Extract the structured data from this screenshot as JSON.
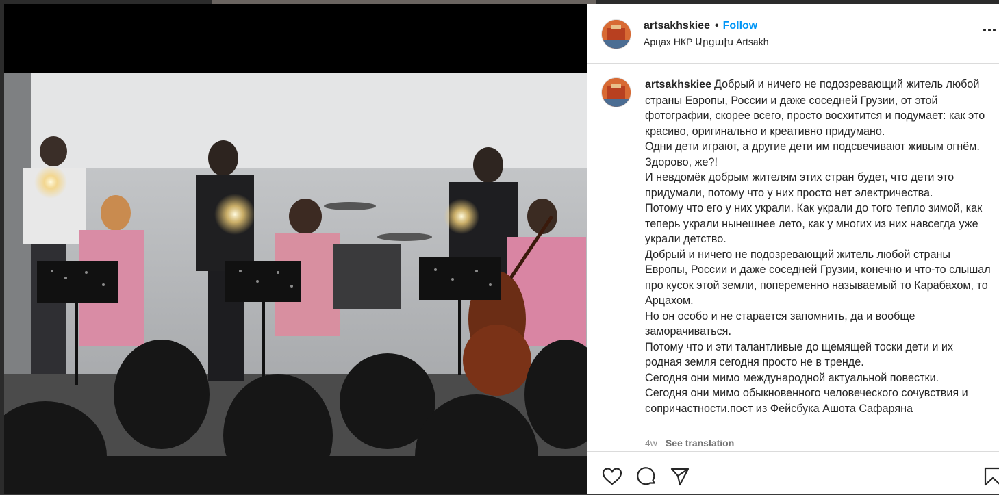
{
  "post": {
    "username": "artsakhskiee",
    "separator": "•",
    "follow_label": "Follow",
    "location": "Арцах НКР Արցախ Artsakh",
    "caption": "Добрый и ничего не подозревающий житель любой страны Европы, России и даже соседней Грузии, от этой фотографии, скорее всего, просто восхитится и подумает: как это красиво, оригинально и креативно придумано.\nОдни дети играют, а другие дети им подсвечивают живым огнём. Здорово, же?!\nИ невдомёк добрым жителям этих стран будет, что дети это придумали, потому что у них просто нет электричества.\nПотому что его у них украли. Как украли до того тепло зимой, как теперь украли нынешнее лето, как у многих из них навсегда уже украли детство.\nДобрый и ничего не подозревающий житель любой страны Европы, России и даже соседней Грузии, конечно и что-то слышал про кусок этой земли, попеременно называемый то Карабахом, то Арцахом.\nНо он особо и не старается запомнить, да и вообще заморачиваться.\nПотому что и эти талантливые до щемящей тоски дети и их родная земля сегодня просто не в тренде.\nСегодня они мимо международной актуальной повестки.\nСегодня они мимо обыкновенного человеческого сочувствия и сопричастности.пост из Фейсбука Ашота Сафаряна",
    "age": "4w",
    "see_translation": "See translation"
  },
  "icons": {
    "more": "more-options-icon",
    "like": "heart-icon",
    "comment": "comment-icon",
    "share": "share-icon",
    "save": "bookmark-icon"
  },
  "colors": {
    "accent": "#0095f6",
    "text": "#262626",
    "muted": "#8e8e8e",
    "divider": "#dbdbdb"
  }
}
